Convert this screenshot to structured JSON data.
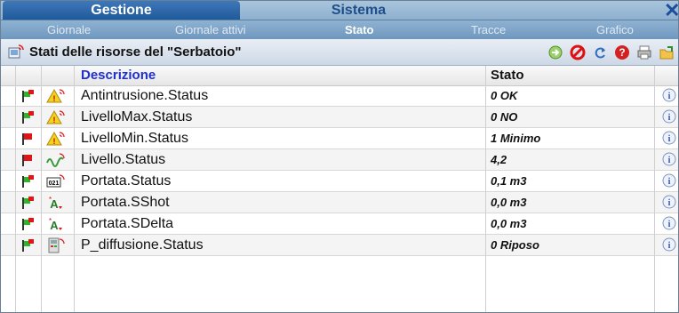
{
  "tabs": [
    {
      "label": "Gestione",
      "active": true
    },
    {
      "label": "Sistema",
      "active": false
    }
  ],
  "subnav": [
    {
      "label": "Giornale",
      "active": false
    },
    {
      "label": "Giornale attivi",
      "active": false
    },
    {
      "label": "Stato",
      "active": true
    },
    {
      "label": "Tracce",
      "active": false
    },
    {
      "label": "Grafico",
      "active": false
    }
  ],
  "panel": {
    "title": "Stati delle risorse del \"Serbatoio\"",
    "tools": [
      "refresh-go-icon",
      "stop-icon",
      "reload-icon",
      "help-icon",
      "print-icon",
      "export-icon"
    ]
  },
  "table": {
    "headers": {
      "description": "Descrizione",
      "state": "Stato"
    },
    "rows": [
      {
        "flag": "green-red",
        "icon": "alarm-warning-icon",
        "name": "Antintrusione.Status",
        "value": "0 OK"
      },
      {
        "flag": "green-red",
        "icon": "alarm-warning-icon",
        "name": "LivelloMax.Status",
        "value": "0 NO"
      },
      {
        "flag": "red",
        "icon": "alarm-warning-icon",
        "name": "LivelloMin.Status",
        "value": "1 Minimo"
      },
      {
        "flag": "red",
        "icon": "analog-wave-icon",
        "name": "Livello.Status",
        "value": "4,2"
      },
      {
        "flag": "green-red",
        "icon": "counter-icon",
        "name": "Portata.Status",
        "value": "0,1 m3"
      },
      {
        "flag": "green-red",
        "icon": "accumulator-icon",
        "name": "Portata.SShot",
        "value": "0,0 m3"
      },
      {
        "flag": "green-red",
        "icon": "accumulator-icon",
        "name": "Portata.SDelta",
        "value": "0,0 m3"
      },
      {
        "flag": "green-red",
        "icon": "device-panel-icon",
        "name": "P_diffusione.Status",
        "value": "0 Riposo"
      }
    ]
  }
}
